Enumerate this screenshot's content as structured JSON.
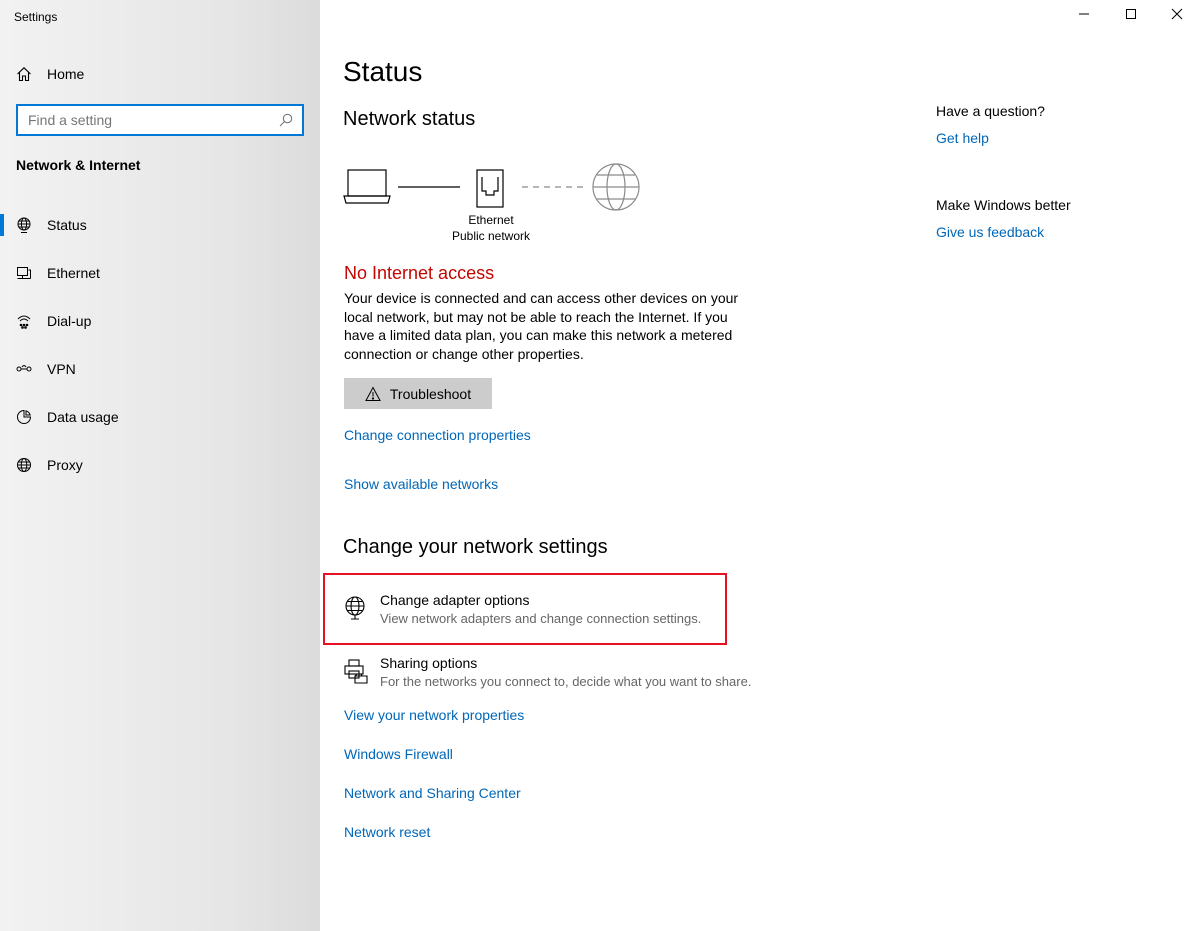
{
  "window": {
    "title": "Settings",
    "controls": {
      "minimize": "minimize-icon",
      "maximize": "maximize-icon",
      "close": "close-icon"
    }
  },
  "sidebar": {
    "home_label": "Home",
    "search_placeholder": "Find a setting",
    "section_title": "Network & Internet",
    "items": [
      {
        "label": "Status",
        "icon": "status-globe-icon",
        "active": true
      },
      {
        "label": "Ethernet",
        "icon": "ethernet-icon",
        "active": false
      },
      {
        "label": "Dial-up",
        "icon": "dial-up-icon",
        "active": false
      },
      {
        "label": "VPN",
        "icon": "vpn-icon",
        "active": false
      },
      {
        "label": "Data usage",
        "icon": "data-usage-icon",
        "active": false
      },
      {
        "label": "Proxy",
        "icon": "proxy-globe-icon",
        "active": false
      }
    ]
  },
  "main": {
    "page_title": "Status",
    "network_status_heading": "Network status",
    "diagram": {
      "adapter_name": "Ethernet",
      "network_type": "Public network"
    },
    "error_title": "No Internet access",
    "error_description": "Your device is connected and can access other devices on your local network, but may not be able to reach the Internet. If you have a limited data plan, you can make this network a metered connection or change other properties.",
    "troubleshoot_label": "Troubleshoot",
    "link_change_connection": "Change connection properties",
    "link_show_networks": "Show available networks",
    "change_settings_heading": "Change your network settings",
    "settings": [
      {
        "title": "Change adapter options",
        "subtitle": "View network adapters and change connection settings."
      },
      {
        "title": "Sharing options",
        "subtitle": "For the networks you connect to, decide what you want to share."
      }
    ],
    "links": [
      "View your network properties",
      "Windows Firewall",
      "Network and Sharing Center",
      "Network reset"
    ]
  },
  "aside": {
    "question_heading": "Have a question?",
    "get_help": "Get help",
    "improve_heading": "Make Windows better",
    "feedback": "Give us feedback"
  },
  "colors": {
    "accent": "#0078d7",
    "link": "#0067b8",
    "error": "#c50500",
    "highlight": "#e81123"
  }
}
